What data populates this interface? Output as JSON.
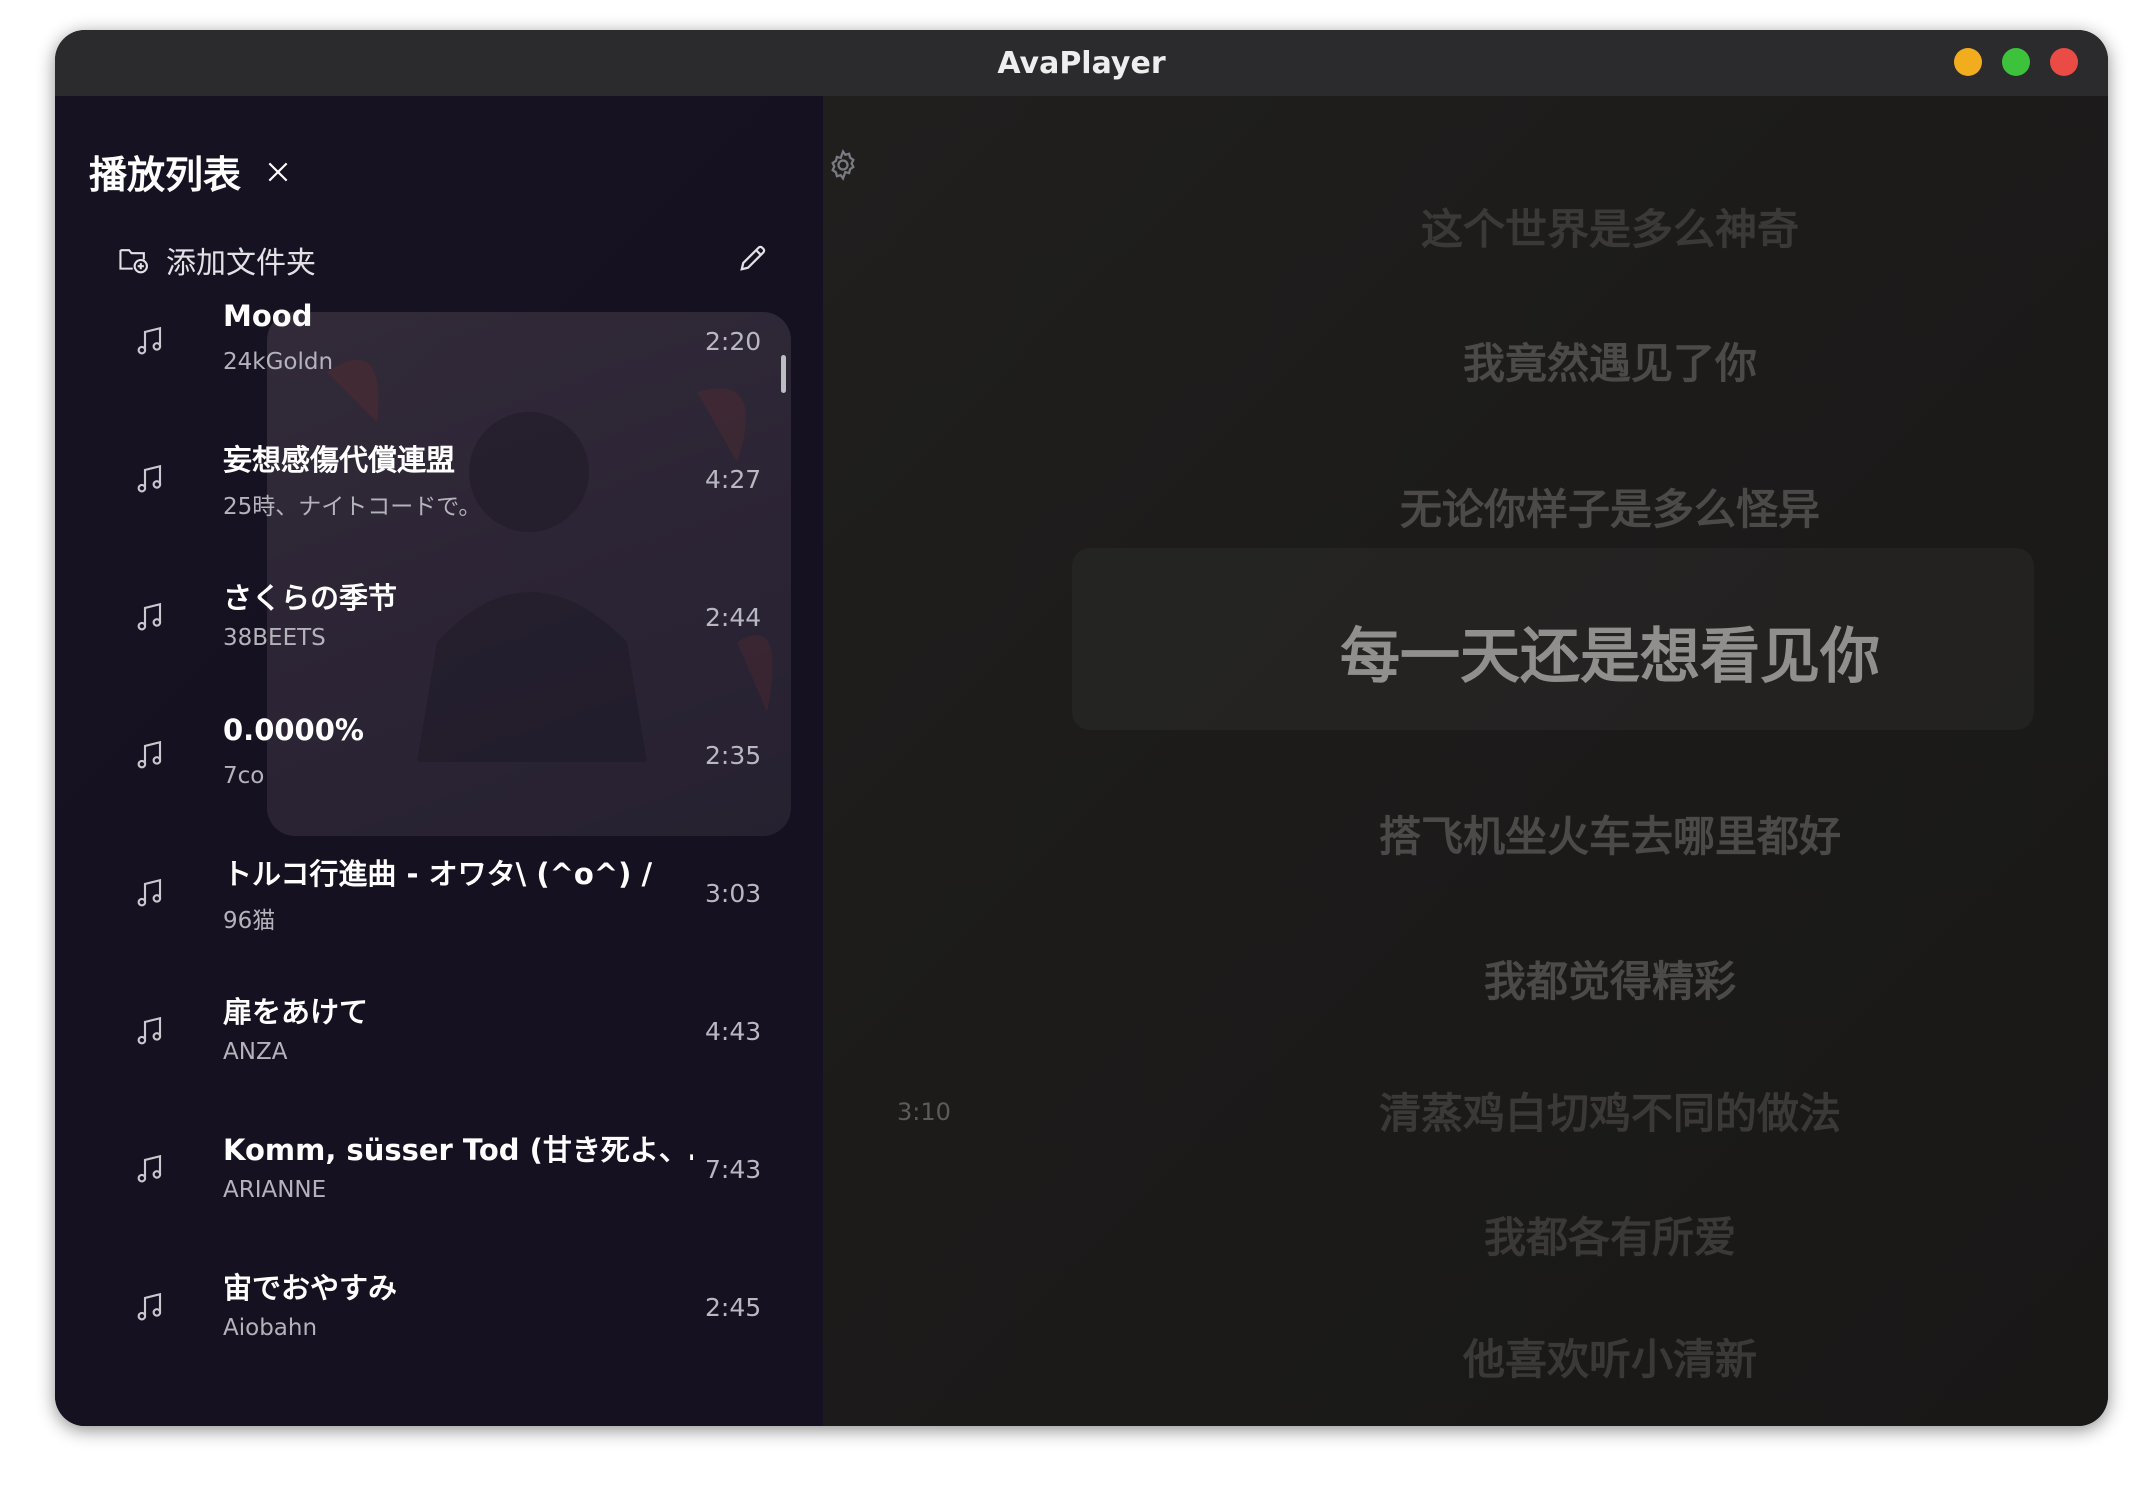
{
  "window": {
    "title": "AvaPlayer"
  },
  "colors": {
    "accent_yellow": "#f2ad1e",
    "accent_green": "#3cc33b",
    "accent_red": "#ea4b45",
    "panel": "#151122"
  },
  "playlist": {
    "title": "播放列表",
    "close_icon": "close-icon",
    "add_folder_label": "添加文件夹",
    "edit_icon": "pencil-icon",
    "tracks": [
      {
        "name": "Mood",
        "artist": "24kGoldn",
        "duration": "2:20"
      },
      {
        "name": "妄想感傷代償連盟",
        "artist": "25時、ナイトコードで。",
        "duration": "4:27"
      },
      {
        "name": "さくらの季节",
        "artist": "38BEETS",
        "duration": "2:44"
      },
      {
        "name": "0.0000%",
        "artist": "7co",
        "duration": "2:35"
      },
      {
        "name": "トルコ行進曲 - オワタ\\ (^o^) /",
        "artist": "96猫",
        "duration": "3:03"
      },
      {
        "name": "扉をあけて",
        "artist": "ANZA",
        "duration": "4:43"
      },
      {
        "name": "Komm, süsser Tod (甘き死よ、…",
        "artist": "ARIANNE",
        "duration": "7:43"
      },
      {
        "name": "宙でおやすみ",
        "artist": "Aiobahn",
        "duration": "2:45"
      }
    ]
  },
  "player": {
    "total_time": "3:10",
    "lyrics": [
      "这个世界是多么神奇",
      "我竟然遇见了你",
      "无论你样子是多么怪异",
      "每一天还是想看见你",
      "搭飞机坐火车去哪里都好",
      "我都觉得精彩",
      "清蒸鸡白切鸡不同的做法",
      "我都各有所爱",
      "他喜欢听小清新"
    ]
  }
}
